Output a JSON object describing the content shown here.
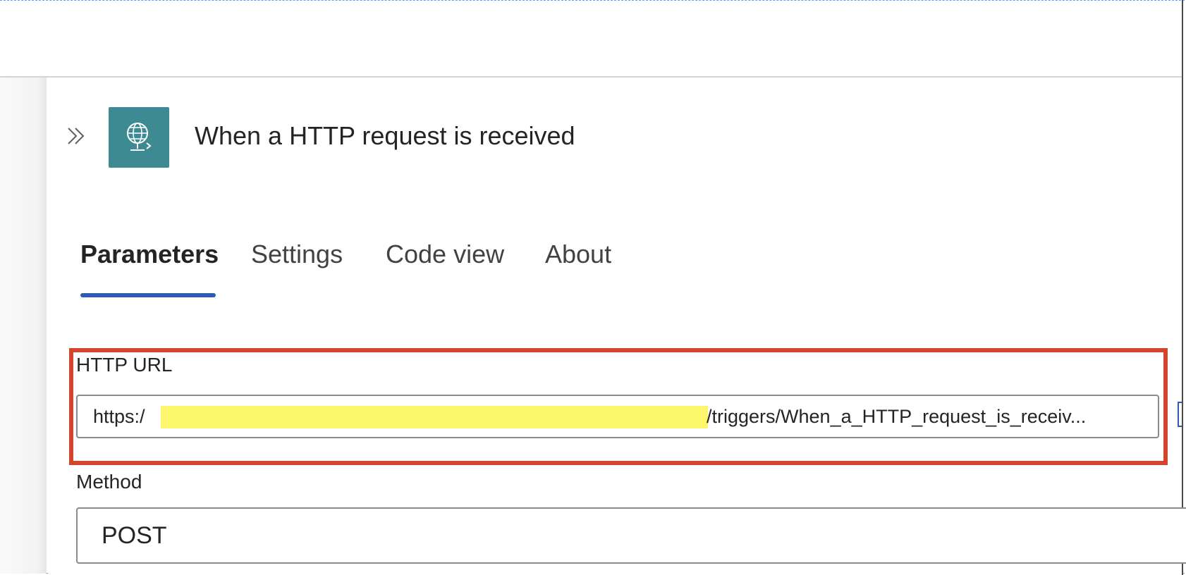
{
  "panel": {
    "title": "When a HTTP request is received",
    "collapse_icon": "double-chevron-right-icon",
    "trigger_icon": "globe-request-icon",
    "trigger_icon_color": "#3d8a93"
  },
  "tabs": [
    {
      "label": "Parameters",
      "active": true
    },
    {
      "label": "Settings",
      "active": false
    },
    {
      "label": "Code view",
      "active": false
    },
    {
      "label": "About",
      "active": false
    }
  ],
  "fields": {
    "http_url": {
      "label": "HTTP URL",
      "value_prefix": "https:/",
      "value_suffix": "/triggers/When_a_HTTP_request_is_receiv..."
    },
    "method": {
      "label": "Method",
      "value": "POST"
    }
  },
  "colors": {
    "highlight_box": "#d2452a",
    "active_tab_underline": "#2e5bb3",
    "redaction": "#fbf66a"
  }
}
